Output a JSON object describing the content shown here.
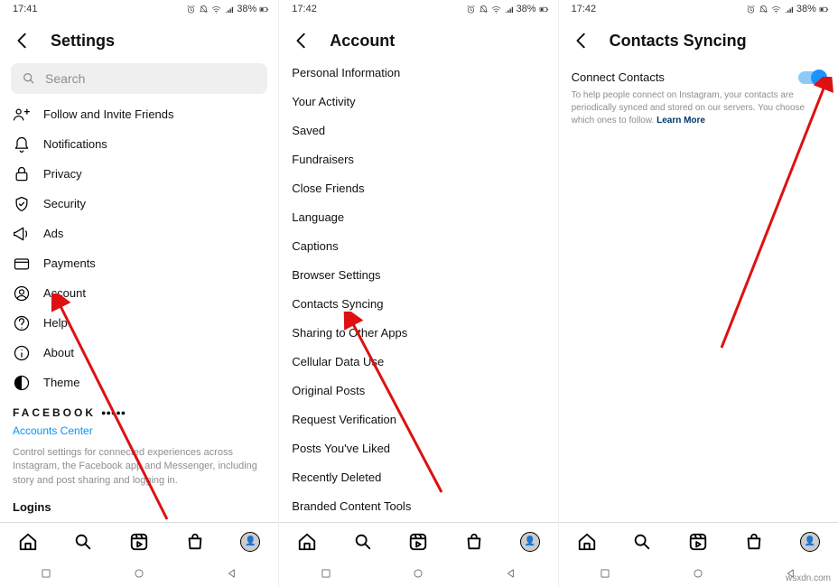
{
  "status": {
    "time1": "17:41",
    "time2": "17:42",
    "time3": "17:42",
    "battery": "38%"
  },
  "screen1": {
    "title": "Settings",
    "search_placeholder": "Search",
    "items": [
      {
        "label": "Follow and Invite Friends"
      },
      {
        "label": "Notifications"
      },
      {
        "label": "Privacy"
      },
      {
        "label": "Security"
      },
      {
        "label": "Ads"
      },
      {
        "label": "Payments"
      },
      {
        "label": "Account"
      },
      {
        "label": "Help"
      },
      {
        "label": "About"
      },
      {
        "label": "Theme"
      }
    ],
    "brand": "FACEBOOK",
    "accounts_center": "Accounts Center",
    "desc": "Control settings for connected experiences across Instagram, the Facebook app and Messenger, including story and post sharing and logging in.",
    "logins": "Logins"
  },
  "screen2": {
    "title": "Account",
    "items": [
      {
        "label": "Personal Information"
      },
      {
        "label": "Your Activity"
      },
      {
        "label": "Saved"
      },
      {
        "label": "Fundraisers"
      },
      {
        "label": "Close Friends"
      },
      {
        "label": "Language"
      },
      {
        "label": "Captions"
      },
      {
        "label": "Browser Settings"
      },
      {
        "label": "Contacts Syncing"
      },
      {
        "label": "Sharing to Other Apps"
      },
      {
        "label": "Cellular Data Use"
      },
      {
        "label": "Original Posts"
      },
      {
        "label": "Request Verification"
      },
      {
        "label": "Posts You've Liked"
      },
      {
        "label": "Recently Deleted"
      },
      {
        "label": "Branded Content Tools"
      }
    ]
  },
  "screen3": {
    "title": "Contacts Syncing",
    "toggle_label": "Connect Contacts",
    "help": "To help people connect on Instagram, your contacts are periodically synced and stored on our servers. You choose which ones to follow. ",
    "learn_more": "Learn More"
  },
  "watermark": "wsxdn.com"
}
